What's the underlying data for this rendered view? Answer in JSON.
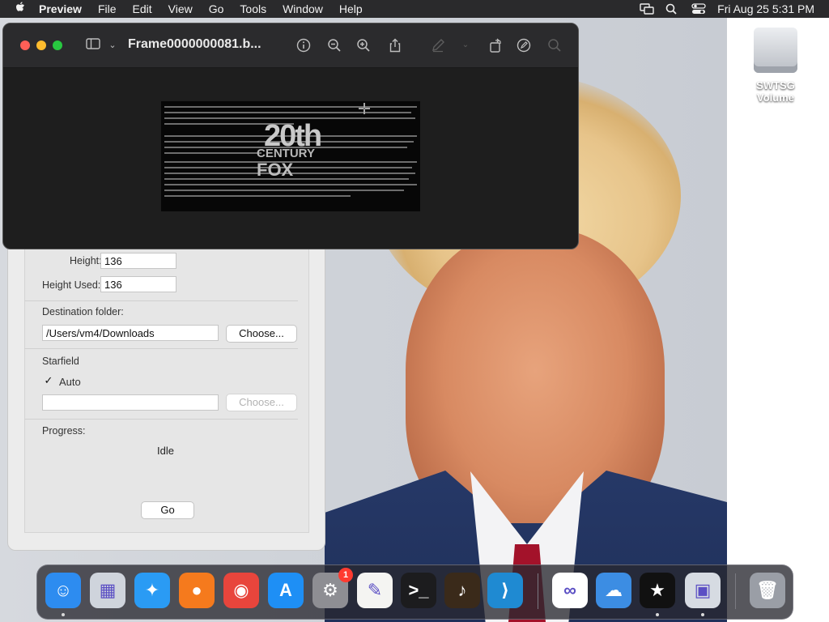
{
  "menubar": {
    "app_name": "Preview",
    "items": [
      "File",
      "Edit",
      "View",
      "Go",
      "Tools",
      "Window",
      "Help"
    ],
    "clock": "Fri Aug 25  5:31 PM",
    "icons": [
      "apple-icon",
      "screen-mirroring-icon",
      "spotlight-search-icon",
      "control-center-icon"
    ]
  },
  "desktop": {
    "volume_label": "SWTSG Volume"
  },
  "preview_window": {
    "title": "Frame0000000081.b...",
    "toolbar_icons": [
      "sidebar-icon",
      "chevron-down-icon",
      "info-icon",
      "zoom-out-icon",
      "zoom-in-icon",
      "share-icon",
      "markup-pen-icon",
      "rotate-icon",
      "markup-icon",
      "search-icon"
    ],
    "document": {
      "logo_line1": "20th",
      "logo_line2": "CENTURY",
      "logo_line3": "FOX"
    }
  },
  "generator_window": {
    "height_label": "Height:",
    "height_value": "136",
    "height_used_label": "Height Used:",
    "height_used_value": "136",
    "destination_label": "Destination folder:",
    "destination_value": "/Users/vm4/Downloads",
    "choose_label": "Choose...",
    "starfield_label": "Starfield",
    "auto_label": "Auto",
    "auto_checked": true,
    "starfield_value": "",
    "starfield_choose_label": "Choose...",
    "progress_label": "Progress:",
    "progress_status": "Idle",
    "go_label": "Go"
  },
  "dock": {
    "apps": [
      {
        "name": "Finder",
        "icon": "finder-icon",
        "color": "#2d8cf0",
        "glyph": "☺"
      },
      {
        "name": "Launchpad",
        "icon": "launchpad-icon",
        "color": "#cfd4dc",
        "glyph": "▦"
      },
      {
        "name": "Safari",
        "icon": "safari-icon",
        "color": "#2a9bf4",
        "glyph": "✦"
      },
      {
        "name": "Firefox",
        "icon": "firefox-icon",
        "color": "#f57a1d",
        "glyph": "●"
      },
      {
        "name": "Chrome",
        "icon": "chrome-icon",
        "color": "#e8453c",
        "glyph": "◉"
      },
      {
        "name": "App Store",
        "icon": "app-store-icon",
        "color": "#1e8ff5",
        "glyph": "A"
      },
      {
        "name": "System Settings",
        "icon": "system-settings-icon",
        "color": "#8e8e93",
        "glyph": "⚙",
        "badge": "1"
      },
      {
        "name": "TextEdit",
        "icon": "textedit-icon",
        "color": "#f4f4f2",
        "glyph": "✎"
      },
      {
        "name": "Terminal",
        "icon": "terminal-icon",
        "color": "#1c1c1e",
        "glyph": ">_"
      },
      {
        "name": "GarageBand",
        "icon": "garageband-icon",
        "color": "#3a2a1a",
        "glyph": "♪"
      },
      {
        "name": "Visual Studio Code",
        "icon": "vscode-icon",
        "color": "#1f8ad2",
        "glyph": "⟩"
      },
      {
        "name": "Visual Studio",
        "icon": "visual-studio-icon",
        "color": "#ffffff",
        "glyph": "∞"
      },
      {
        "name": "Weather",
        "icon": "weather-icon",
        "color": "#3c8de3",
        "glyph": "☁"
      },
      {
        "name": "Star Wars Title Generator",
        "icon": "star-wars-generator-icon",
        "color": "#111111",
        "glyph": "★"
      },
      {
        "name": "Preview",
        "icon": "preview-icon",
        "color": "#d6dbe2",
        "glyph": "▣"
      },
      {
        "name": "Trash",
        "icon": "trash-icon",
        "color": "#9a9ea6",
        "glyph": "🗑"
      }
    ]
  }
}
